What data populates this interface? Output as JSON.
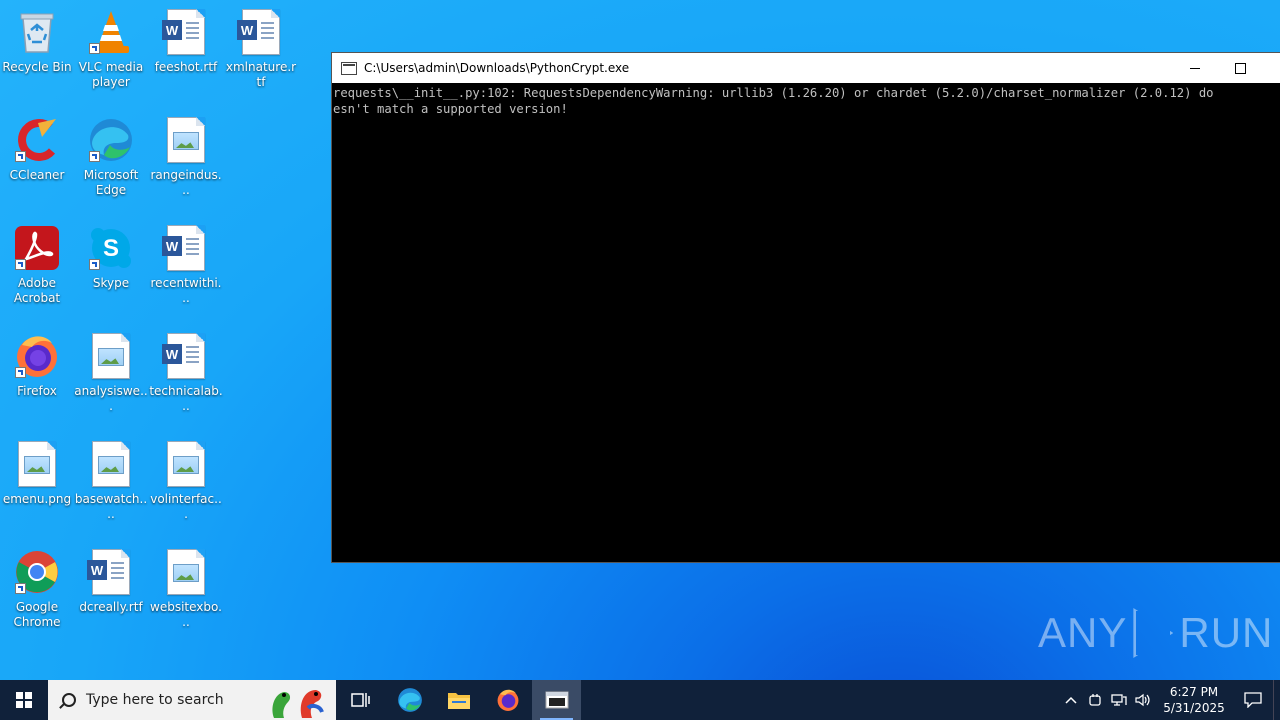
{
  "desktop_icons": [
    {
      "name": "recycle-bin",
      "label": "Recycle Bin"
    },
    {
      "name": "vlc",
      "label": "VLC media player"
    },
    {
      "name": "feeshot",
      "label": "feeshot.rtf"
    },
    {
      "name": "xmlnature",
      "label": "xmlnature.rtf"
    },
    {
      "name": "ccleaner",
      "label": "CCleaner"
    },
    {
      "name": "edge",
      "label": "Microsoft Edge"
    },
    {
      "name": "rangeindus",
      "label": "rangeindus..."
    },
    {
      "name": "acrobat",
      "label": "Adobe Acrobat"
    },
    {
      "name": "skype",
      "label": "Skype"
    },
    {
      "name": "recentwithi",
      "label": "recentwithi..."
    },
    {
      "name": "firefox",
      "label": "Firefox"
    },
    {
      "name": "analysiswe",
      "label": "analysiswe..."
    },
    {
      "name": "technicalab",
      "label": "technicalab..."
    },
    {
      "name": "emenu",
      "label": "emenu.png"
    },
    {
      "name": "basewatch",
      "label": "basewatch...."
    },
    {
      "name": "volinterfac",
      "label": "volinterfac..."
    },
    {
      "name": "chrome",
      "label": "Google Chrome"
    },
    {
      "name": "dcreally",
      "label": "dcreally.rtf"
    },
    {
      "name": "websitexbo",
      "label": "websitexbo..."
    }
  ],
  "console": {
    "title": "C:\\Users\\admin\\Downloads\\PythonCrypt.exe",
    "line1": "requests\\__init__.py:102: RequestsDependencyWarning: urllib3 (1.26.20) or chardet (5.2.0)/charset_normalizer (2.0.12) do",
    "line2": "esn't match a supported version!"
  },
  "watermark": {
    "left": "ANY",
    "right": "RUN"
  },
  "taskbar": {
    "search_placeholder": "Type here to search",
    "time": "6:27 PM",
    "date": "5/31/2025"
  },
  "colors": {
    "taskbar": "#10213a",
    "console_bg": "#000000",
    "console_text": "#c0c0c0"
  }
}
